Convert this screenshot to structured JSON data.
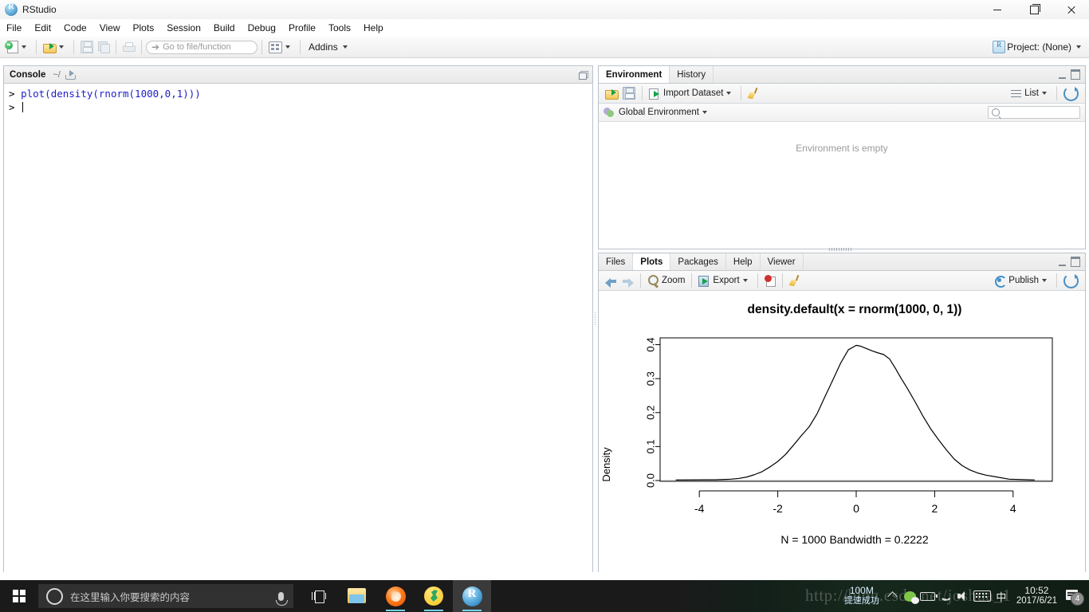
{
  "window": {
    "title": "RStudio",
    "icon": "r-logo-icon",
    "controls": {
      "minimize": "minimize",
      "maximize": "maximize",
      "close": "close"
    }
  },
  "menubar": {
    "items": [
      "File",
      "Edit",
      "Code",
      "View",
      "Plots",
      "Session",
      "Build",
      "Debug",
      "Profile",
      "Tools",
      "Help"
    ]
  },
  "toolbar": {
    "new_file": "new-file",
    "open_file": "open-file",
    "save": "save",
    "save_all": "save-all",
    "print": "print",
    "goto_placeholder": "Go to file/function",
    "panes": "workspace-panes",
    "addins_label": "Addins",
    "project_label": "Project: (None)"
  },
  "console": {
    "title": "Console",
    "path": "~/",
    "lines": [
      {
        "prompt": "> ",
        "code": "plot(density(rnorm(1000,0,1)))"
      },
      {
        "prompt": "> ",
        "code": ""
      }
    ]
  },
  "environment": {
    "tabs": [
      {
        "label": "Environment",
        "active": true
      },
      {
        "label": "History",
        "active": false
      }
    ],
    "toolbar": {
      "load": "load-workspace",
      "save": "save-workspace",
      "import_label": "Import Dataset",
      "clear": "clear-objects",
      "view_label": "List",
      "refresh": "refresh"
    },
    "selector_label": "Global Environment",
    "search_placeholder": "",
    "empty_message": "Environment is empty"
  },
  "plots": {
    "tabs": [
      {
        "label": "Files",
        "active": false
      },
      {
        "label": "Plots",
        "active": true
      },
      {
        "label": "Packages",
        "active": false
      },
      {
        "label": "Help",
        "active": false
      },
      {
        "label": "Viewer",
        "active": false
      }
    ],
    "toolbar": {
      "back": "previous-plot",
      "forward": "next-plot",
      "zoom_label": "Zoom",
      "export_label": "Export",
      "remove": "remove-plot",
      "clear_all": "clear-all-plots",
      "publish_label": "Publish",
      "refresh": "refresh"
    }
  },
  "chart_data": {
    "type": "line",
    "title": "density.default(x = rnorm(1000, 0, 1))",
    "xlabel": "N = 1000   Bandwidth = 0.2222",
    "ylabel": "Density",
    "xlim": [
      -5.0,
      5.0
    ],
    "ylim": [
      0.0,
      0.42
    ],
    "xticks": [
      -4,
      -2,
      0,
      2,
      4
    ],
    "xtick_labels": [
      "-4",
      "-2",
      "0",
      "2",
      "4"
    ],
    "yticks": [
      0.0,
      0.1,
      0.2,
      0.3,
      0.4
    ],
    "ytick_labels": [
      "0.0",
      "0.1",
      "0.2",
      "0.3",
      "0.4"
    ],
    "grid": false,
    "legend": null,
    "line_color": "#000000",
    "series": [
      {
        "name": "density",
        "x": [
          -3.8,
          -3.6,
          -3.4,
          -3.2,
          -3.0,
          -2.8,
          -2.6,
          -2.4,
          -2.2,
          -2.0,
          -1.8,
          -1.6,
          -1.4,
          -1.2,
          -1.0,
          -0.8,
          -0.6,
          -0.4,
          -0.2,
          0.0,
          0.1,
          0.25,
          0.4,
          0.55,
          0.7,
          0.85,
          1.0,
          1.15,
          1.3,
          1.5,
          1.7,
          1.9,
          2.1,
          2.3,
          2.5,
          2.7,
          2.9,
          3.1,
          3.3,
          3.6,
          3.9
        ],
        "y": [
          0.002,
          0.002,
          0.003,
          0.004,
          0.006,
          0.01,
          0.017,
          0.026,
          0.04,
          0.056,
          0.077,
          0.104,
          0.132,
          0.158,
          0.196,
          0.246,
          0.295,
          0.345,
          0.385,
          0.398,
          0.396,
          0.389,
          0.382,
          0.376,
          0.371,
          0.358,
          0.33,
          0.3,
          0.272,
          0.232,
          0.19,
          0.152,
          0.12,
          0.09,
          0.063,
          0.044,
          0.031,
          0.022,
          0.016,
          0.01,
          0.004
        ]
      }
    ]
  },
  "taskbar": {
    "start": "windows-start",
    "search_placeholder": "在这里输入你要搜索的内容",
    "cortana": "cortana-icon",
    "mic": "microphone-icon",
    "apps": [
      {
        "name": "task-view",
        "running": false,
        "active": false
      },
      {
        "name": "file-explorer",
        "running": false,
        "active": false
      },
      {
        "name": "firefox",
        "running": true,
        "active": false
      },
      {
        "name": "music-player",
        "running": true,
        "active": false
      },
      {
        "name": "rstudio",
        "running": true,
        "active": true
      }
    ],
    "tray": {
      "network_speed": "100M",
      "network_status": "提速成功",
      "ime": "中",
      "time": "10:52",
      "date": "2017/6/21",
      "notification_count": "4"
    }
  },
  "watermark": {
    "text": "http://blog.csdn.net/joshua_1"
  }
}
